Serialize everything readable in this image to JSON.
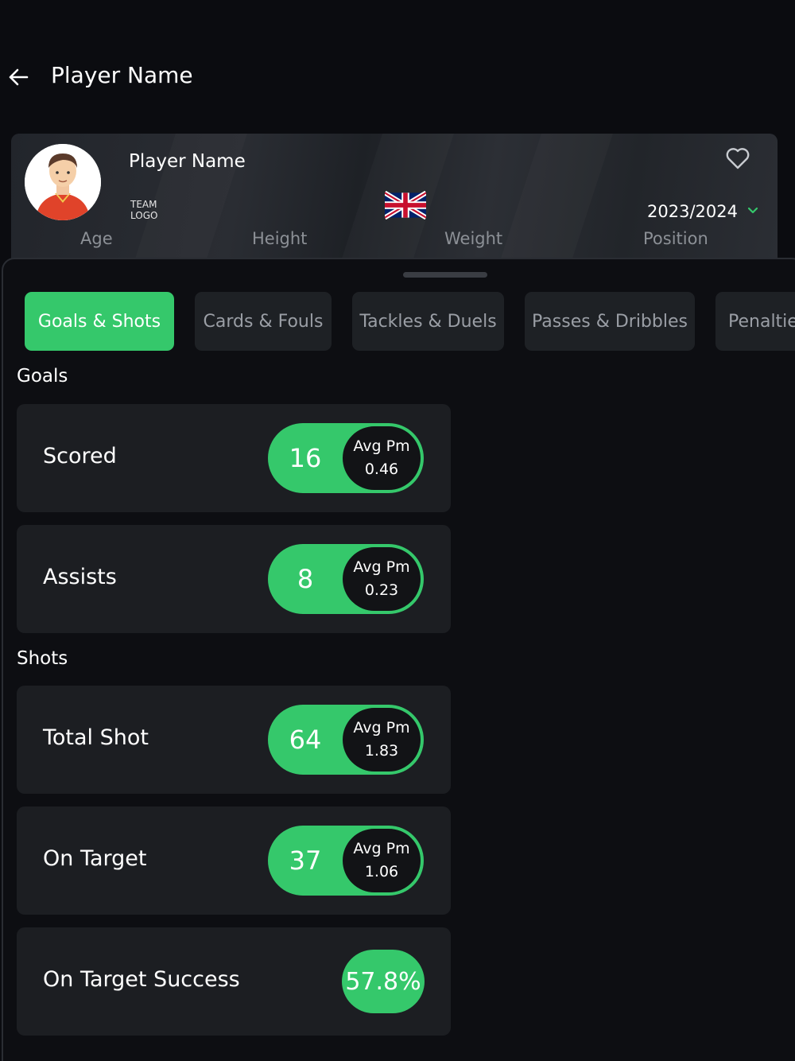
{
  "header": {
    "title": "Player Name"
  },
  "player": {
    "name": "Player Name",
    "team_logo_line1": "TEAM",
    "team_logo_line2": "LOGO",
    "season": "2023/2024",
    "meta_labels": [
      "Age",
      "Height",
      "Weight",
      "Position"
    ]
  },
  "tabs": [
    {
      "label": "Goals & Shots",
      "active": true
    },
    {
      "label": "Cards & Fouls",
      "active": false
    },
    {
      "label": "Tackles & Duels",
      "active": false
    },
    {
      "label": "Passes & Dribbles",
      "active": false
    },
    {
      "label": "Penalties",
      "active": false
    }
  ],
  "sections": [
    {
      "title": "Goals"
    },
    {
      "title": "Shots"
    }
  ],
  "stats": {
    "avg_label": "Avg Pm",
    "items": [
      {
        "label": "Scored",
        "value": "16",
        "avg": "0.46"
      },
      {
        "label": "Assists",
        "value": "8",
        "avg": "0.23"
      },
      {
        "label": "Total Shot",
        "value": "64",
        "avg": "1.83"
      },
      {
        "label": "On Target",
        "value": "37",
        "avg": "1.06"
      },
      {
        "label": "On Target Success",
        "value": "57.8%"
      }
    ]
  },
  "colors": {
    "accent": "#35c86b",
    "background": "#0b0c10",
    "card": "#1c1e22",
    "muted_text": "#8c9096"
  },
  "icons": [
    "back-arrow-icon",
    "heart-icon",
    "chevron-down-icon",
    "uk-flag-icon",
    "player-avatar"
  ]
}
